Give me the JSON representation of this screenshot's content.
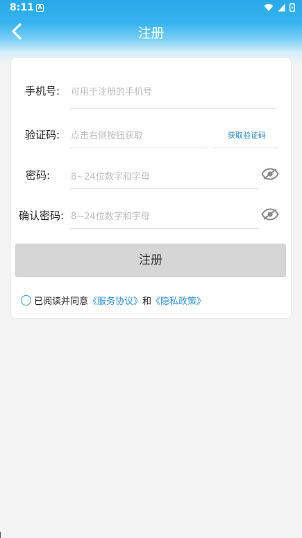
{
  "status_bar": {
    "time": "8:11",
    "notification_glyph": "A",
    "icons": [
      "wifi-icon",
      "signal-icon",
      "battery-icon"
    ]
  },
  "header": {
    "title": "注册",
    "back_icon": "chevron-left-icon"
  },
  "form": {
    "phone": {
      "label": "手机号:",
      "placeholder": "可用于注册的手机号"
    },
    "code": {
      "label": "验证码:",
      "placeholder": "点击右侧按钮获取",
      "button": "获取验证码"
    },
    "password": {
      "label": "密码:",
      "placeholder": "8~24位数字和字母",
      "toggle_icon": "eye-off-icon"
    },
    "confirm": {
      "label": "确认密码:",
      "placeholder": "8~24位数字和字母",
      "toggle_icon": "eye-off-icon"
    },
    "submit": "注册"
  },
  "agreement": {
    "prefix": "已阅读并同意",
    "service": "《服务协议》",
    "and": "和",
    "privacy": "《隐私政策》"
  },
  "colors": {
    "header_blue": "#2aa9ea",
    "link_blue": "#2f8fd3",
    "button_gray": "#d6d6d6",
    "placeholder_gray": "#bdbdbd"
  }
}
